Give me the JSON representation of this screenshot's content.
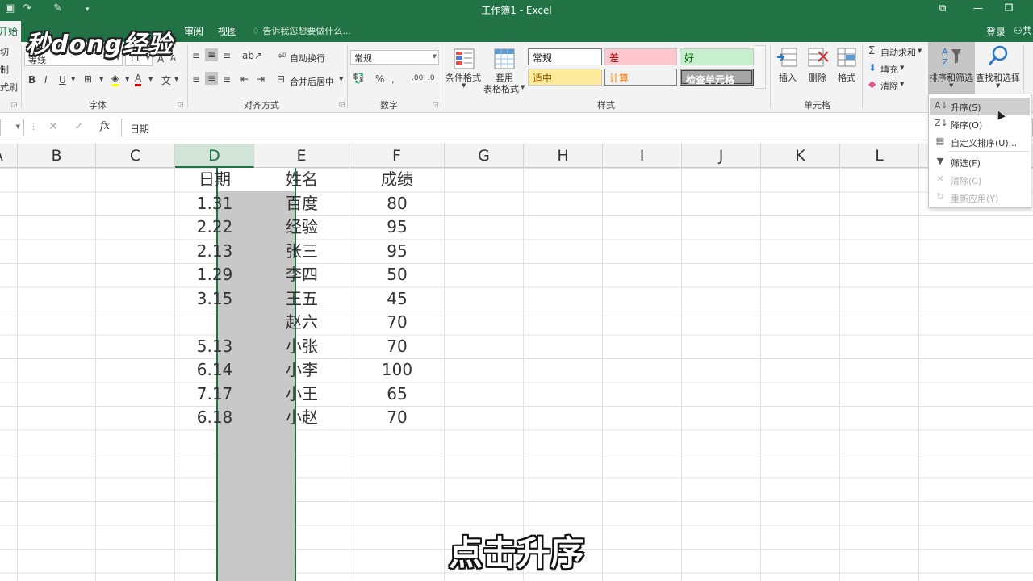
{
  "window": {
    "title": "工作簿1 - Excel",
    "login_label": "登录",
    "share_label": "共"
  },
  "tabs": {
    "home": "开始",
    "review": "审阅",
    "view": "视图",
    "tell_me": "告诉我您想要做什么..."
  },
  "ribbon": {
    "font": {
      "font_name": "等线",
      "font_size": "11",
      "group_label": "字体"
    },
    "clipboard": {
      "cut": "切",
      "copy": "制",
      "paint": "式刷"
    },
    "alignment": {
      "wrap_text": "自动换行",
      "merge_center": "合并后居中",
      "group_label": "对齐方式"
    },
    "number": {
      "format": "常规",
      "group_label": "数字"
    },
    "styles": {
      "conditional_format": "条件格式",
      "format_as_table_1": "套用",
      "format_as_table_2": "表格格式",
      "normal": "常规",
      "bad": "差",
      "good": "好",
      "neutral": "适中",
      "calculation": "计算",
      "check_cell": "检查单元格",
      "group_label": "样式",
      "bad_color": "#ffc7ce",
      "good_color": "#c6efce",
      "neutral_color": "#ffeb9c",
      "check_color": "#a5a5a5"
    },
    "cells": {
      "insert": "插入",
      "delete": "删除",
      "format": "格式",
      "group_label": "单元格"
    },
    "editing": {
      "autosum": "自动求和",
      "fill": "填充",
      "clear": "清除",
      "sort_filter": "排序和筛选",
      "find_select": "查找和选择"
    }
  },
  "formula_bar": {
    "content": "日期",
    "fx": "fx"
  },
  "grid": {
    "columns": [
      "A",
      "B",
      "C",
      "D",
      "E",
      "F",
      "G",
      "H",
      "I",
      "J",
      "K",
      "L"
    ],
    "selected_column": "D",
    "rows": [
      [
        "日期",
        "姓名",
        "成绩"
      ],
      [
        "1.31",
        "百度",
        "80"
      ],
      [
        "2.22",
        "经验",
        "95"
      ],
      [
        "2.13",
        "张三",
        "95"
      ],
      [
        "1.29",
        "李四",
        "50"
      ],
      [
        "3.15",
        "王五",
        "45"
      ],
      [
        "",
        "赵六",
        "70"
      ],
      [
        "5.13",
        "小张",
        "70"
      ],
      [
        "6.14",
        "小李",
        "100"
      ],
      [
        "7.17",
        "小王",
        "65"
      ],
      [
        "6.18",
        "小赵",
        "70"
      ]
    ]
  },
  "sort_menu": {
    "items": [
      {
        "label": "升序(S)",
        "icon": "sort-ascending-icon",
        "enabled": true,
        "hover": true
      },
      {
        "label": "降序(O)",
        "icon": "sort-descending-icon",
        "enabled": true,
        "hover": false
      },
      {
        "label": "自定义排序(U)...",
        "icon": "custom-sort-icon",
        "enabled": true,
        "hover": false
      },
      {
        "label": "筛选(F)",
        "icon": "filter-icon",
        "enabled": true,
        "hover": false
      },
      {
        "label": "清除(C)",
        "icon": "clear-filter-icon",
        "enabled": false,
        "hover": false
      },
      {
        "label": "重新应用(Y)",
        "icon": "reapply-icon",
        "enabled": false,
        "hover": false
      }
    ]
  },
  "overlay": {
    "watermark": "秒dong经验",
    "subtitle": "点击升序"
  },
  "colors": {
    "excel_green": "#217346",
    "selected_col_bg": "#c8c8c8"
  }
}
